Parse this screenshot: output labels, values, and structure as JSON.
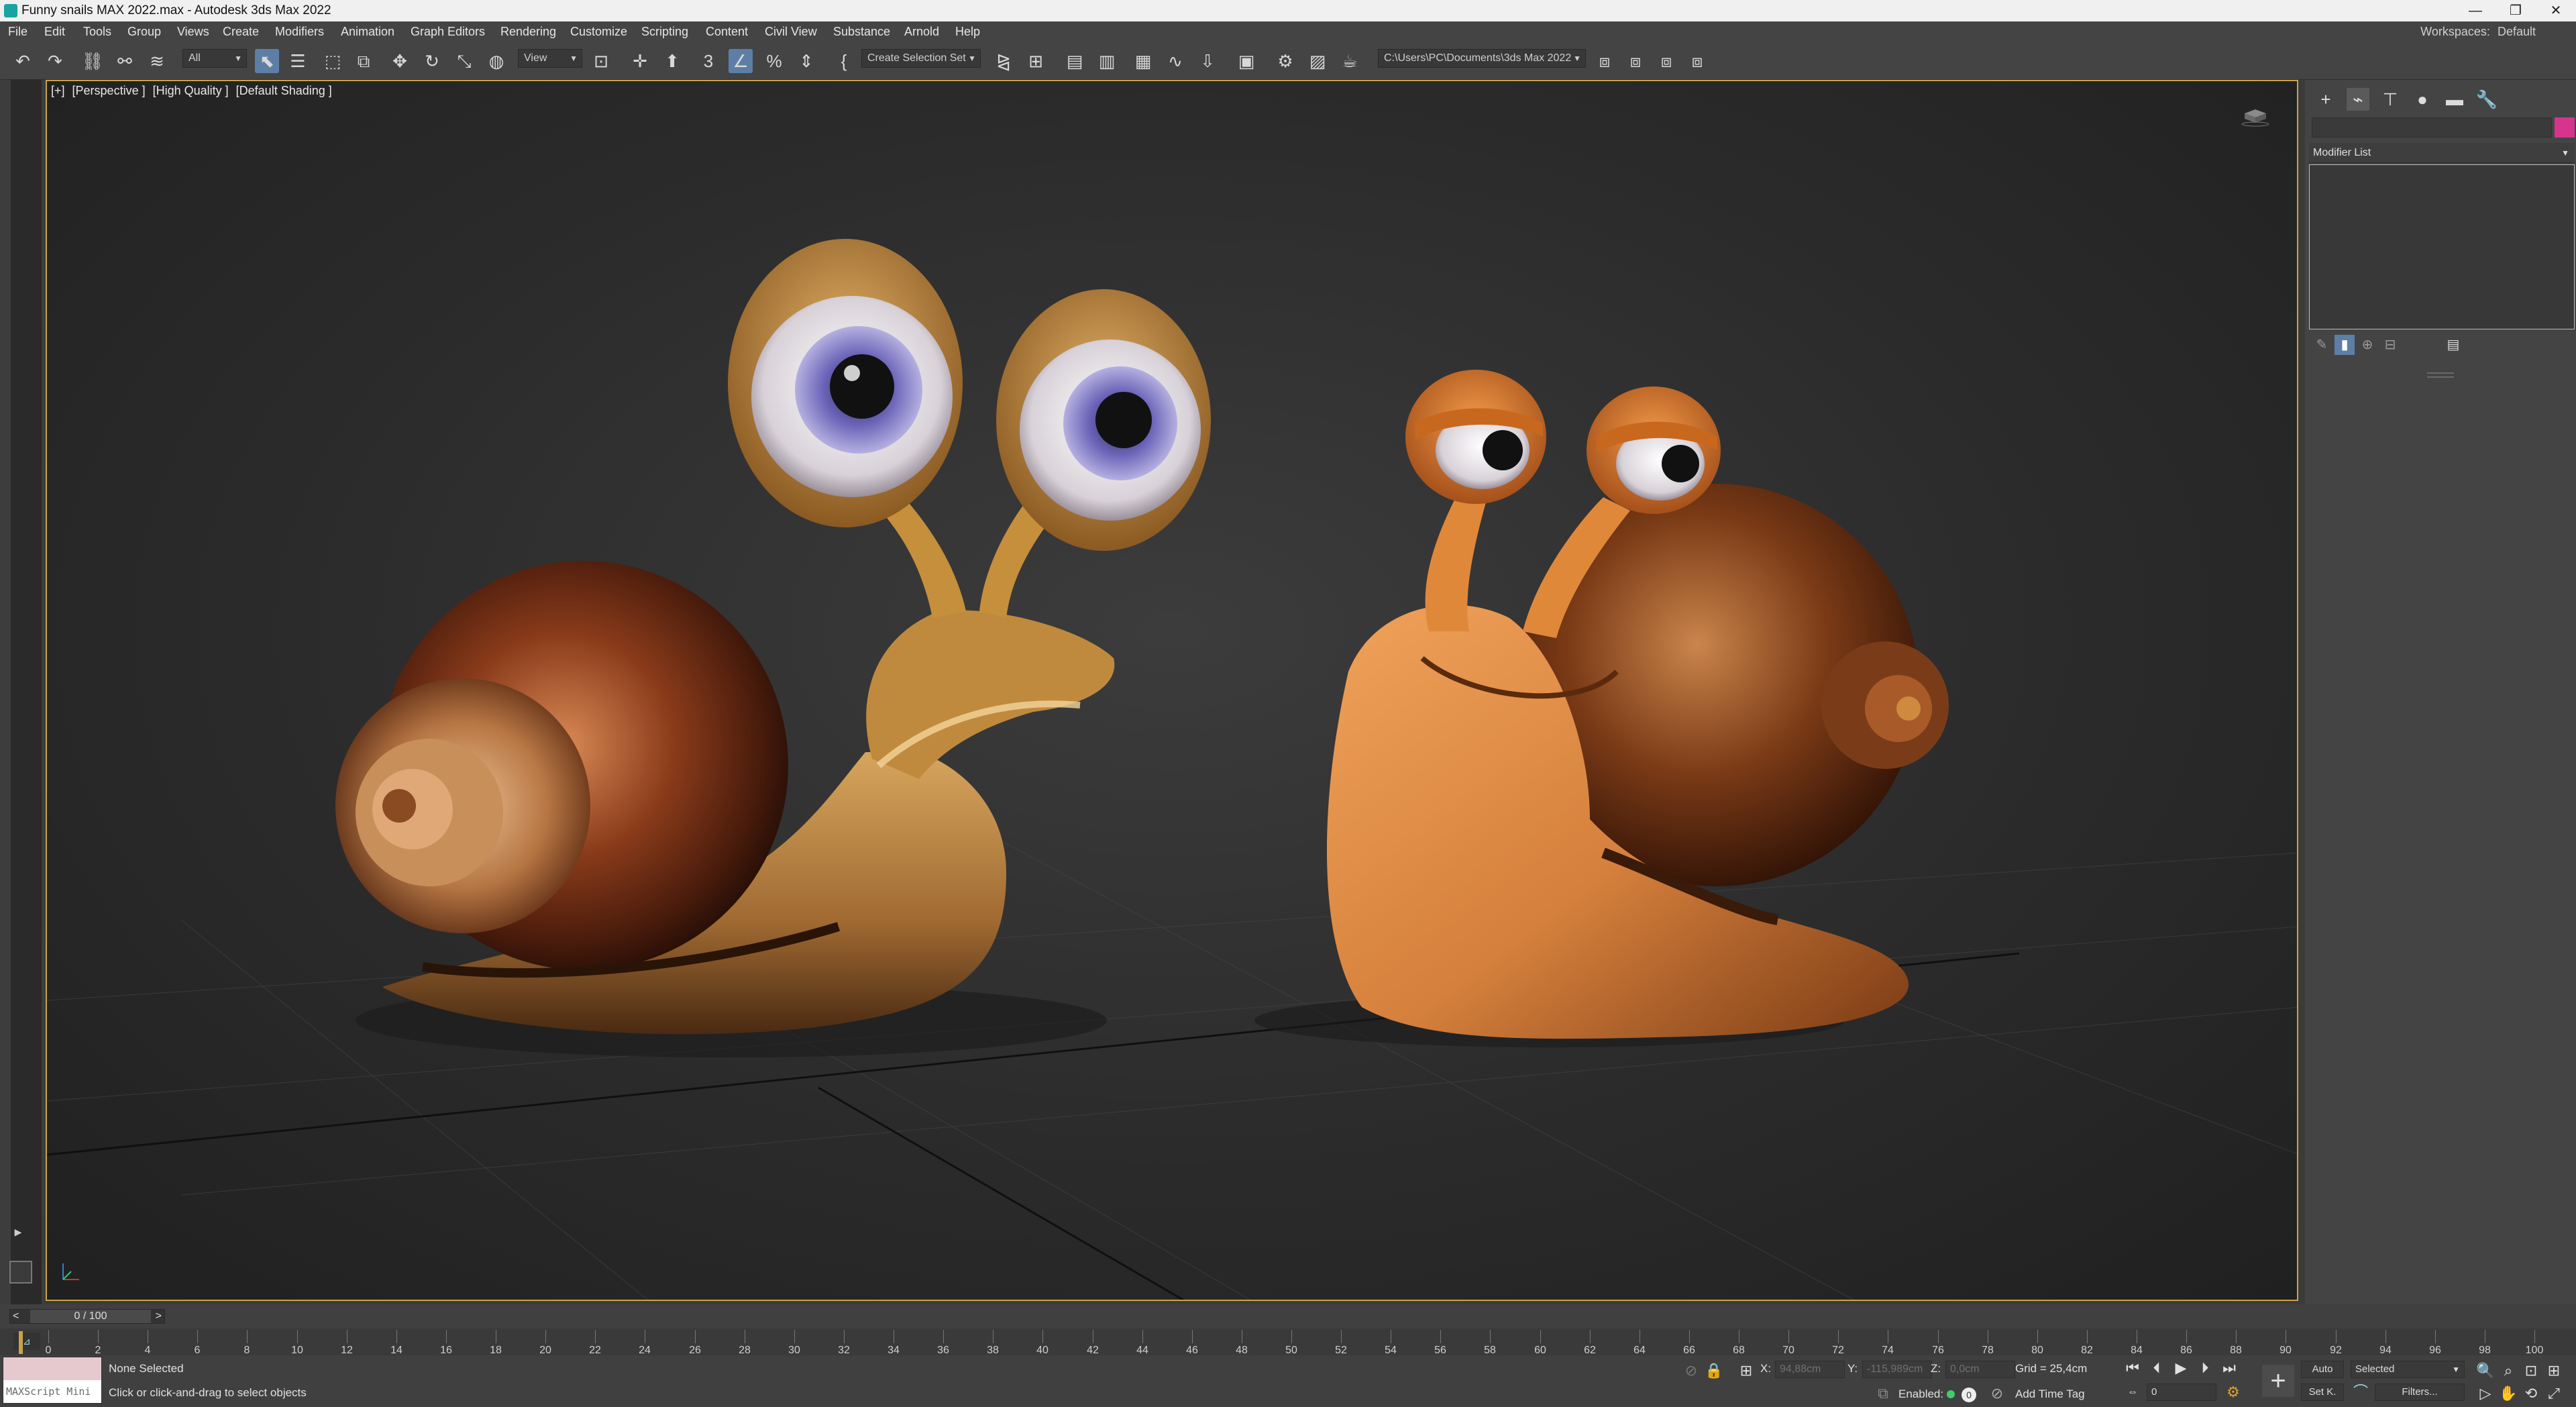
{
  "window": {
    "title": "Funny snails MAX 2022.max - Autodesk 3ds Max 2022",
    "controls": [
      "—",
      "❐",
      "✕"
    ]
  },
  "menubar": {
    "items": [
      "File",
      "Edit",
      "Tools",
      "Group",
      "Views",
      "Create",
      "Modifiers",
      "Animation",
      "Graph Editors",
      "Rendering",
      "Customize",
      "Scripting",
      "Content",
      "Civil View",
      "Substance",
      "Arnold",
      "Help"
    ],
    "workspaces_label": "Workspaces:",
    "workspaces_value": "Default"
  },
  "toolbar": {
    "selection_filter": "All",
    "ref_coord_system": "View",
    "named_selection_set": "Create Selection Set",
    "project_path": "C:\\Users\\PC\\Documents\\3ds Max 2022",
    "snap_label": "3",
    "icons": [
      "undo-icon",
      "redo-icon",
      "link-icon",
      "unlink-icon",
      "bind-spacewarp-icon",
      "select-object-icon",
      "select-by-name-icon",
      "rect-region-icon",
      "window-crossing-icon",
      "move-icon",
      "rotate-icon",
      "scale-icon",
      "placement-icon",
      "pivot-icon",
      "manipulate-icon",
      "keyboard-shortcut-icon",
      "snap-toggle-icon",
      "angle-snap-icon",
      "percent-snap-icon",
      "spinner-snap-icon",
      "edit-named-sel-icon",
      "mirror-icon",
      "align-icon",
      "scene-explorer-icon",
      "layer-explorer-icon",
      "ribbon-icon",
      "curve-editor-icon",
      "schematic-view-icon",
      "material-editor-icon",
      "render-setup-icon",
      "rendered-frame-icon",
      "render-production-icon",
      "render-teapot-icon"
    ]
  },
  "viewport": {
    "label_plus": "[+]",
    "label_view": "[Perspective ]",
    "label_quality": "[High Quality ]",
    "label_shading": "[Default Shading ]"
  },
  "command_panel": {
    "tabs": [
      "create-tab",
      "modify-tab",
      "hierarchy-tab",
      "motion-tab",
      "display-tab",
      "utilities-tab"
    ],
    "object_color": "#d6348f",
    "modifier_list": "Modifier List"
  },
  "time_slider": {
    "value": "0 / 100",
    "prev": "<",
    "next": ">"
  },
  "track_bar": {
    "ticks": [
      "0",
      "2",
      "4",
      "6",
      "8",
      "10",
      "12",
      "14",
      "16",
      "18",
      "20",
      "22",
      "24",
      "26",
      "28",
      "30",
      "32",
      "34",
      "36",
      "38",
      "40",
      "42",
      "44",
      "46",
      "48",
      "50",
      "52",
      "54",
      "56",
      "58",
      "60",
      "62",
      "64",
      "66",
      "68",
      "70",
      "72",
      "74",
      "76",
      "78",
      "80",
      "82",
      "84",
      "86",
      "88",
      "90",
      "92",
      "94",
      "96",
      "98",
      "100"
    ]
  },
  "status": {
    "maxscript": "MAXScript Mini",
    "selection": "None Selected",
    "prompt": "Click or click-and-drag to select objects",
    "x_label": "X:",
    "x_value": "94,88cm",
    "y_label": "Y:",
    "y_value": "-115,989cm",
    "z_label": "Z:",
    "z_value": "0,0cm",
    "grid": "Grid = 25,4cm",
    "enabled_label": "Enabled:",
    "add_time_tag": "Add Time Tag",
    "auto_key": "Auto",
    "set_key": "Set K.",
    "key_mode": "Selected",
    "filters": "Filters...",
    "frame": "0",
    "accent_color": "#c9a349"
  }
}
